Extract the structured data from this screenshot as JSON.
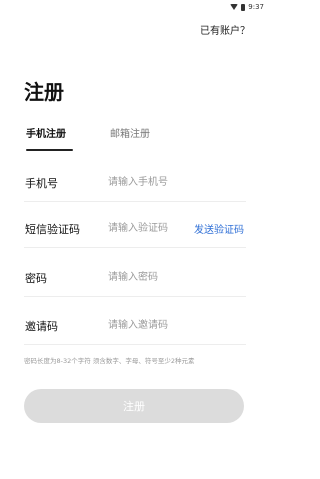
{
  "status_bar": {
    "time": "9:37"
  },
  "header": {
    "have_account": "已有账户？"
  },
  "page": {
    "title": "注册"
  },
  "tabs": [
    {
      "label": "手机注册",
      "active": true
    },
    {
      "label": "邮箱注册",
      "active": false
    }
  ],
  "form": {
    "phone": {
      "label": "手机号",
      "placeholder": "请输入手机号"
    },
    "sms": {
      "label": "短信验证码",
      "placeholder": "请输入验证码",
      "action": "发送验证码"
    },
    "password": {
      "label": "密码",
      "placeholder": "请输入密码"
    },
    "invite": {
      "label": "邀请码",
      "placeholder": "请输入邀请码"
    },
    "hint": "密码长度为8-32个字符 须含数字、字母、符号至少2种元素"
  },
  "submit": {
    "label": "注册"
  },
  "colors": {
    "accent": "#2f6fd6",
    "button_disabled": "#dcdcdc"
  }
}
